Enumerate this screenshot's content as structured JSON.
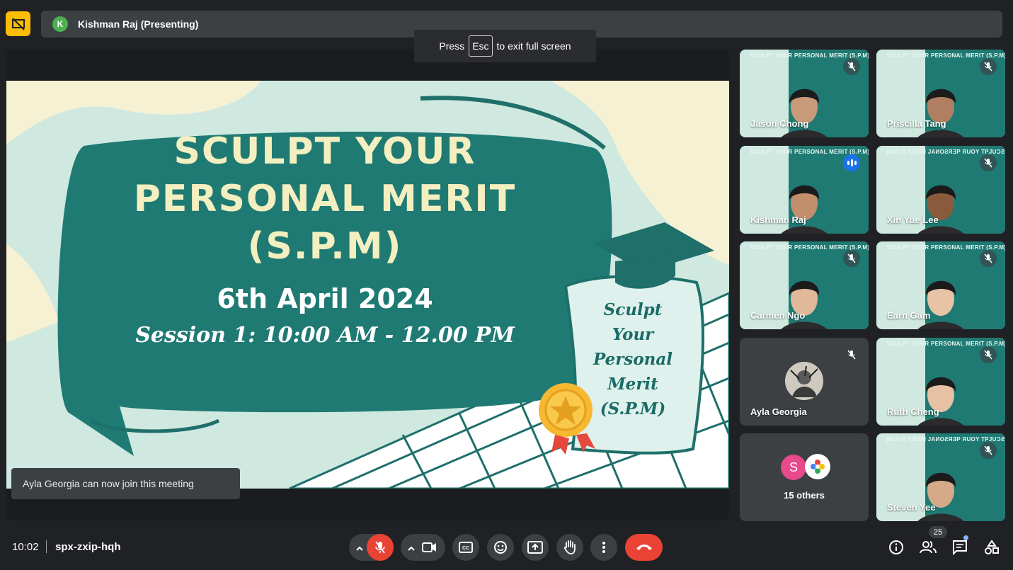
{
  "top_bar": {
    "presenter_initial": "K",
    "presenter_label": "Kishman Raj (Presenting)"
  },
  "fullscreen_hint": {
    "prefix": "Press",
    "key": "Esc",
    "suffix": "to exit full screen"
  },
  "slide": {
    "title_line1": "SCULPT YOUR",
    "title_line2": "PERSONAL MERIT",
    "title_line3": "(S.P.M)",
    "date": "6th April 2024",
    "session": "Session 1: 10:00 AM - 12.00 PM",
    "scroll_line1": "Sculpt",
    "scroll_line2": "Your",
    "scroll_line3": "Personal",
    "scroll_line4": "Merit",
    "scroll_line5": "(S.P.M)"
  },
  "toast": {
    "text": "Ayla Georgia can now join this meeting"
  },
  "participants": [
    {
      "name": "Jason Chong",
      "banner": "SCULPT YOUR PERSONAL MERIT (S.P.M)",
      "muted": true
    },
    {
      "name": "Priscilla Tang",
      "banner": "SCULPT YOUR PERSONAL MERIT (S.P.M)",
      "muted": true
    },
    {
      "name": "Kishman Raj",
      "banner": "SCULPT YOUR PERSONAL MERIT (S.P.M)",
      "muted": false,
      "speaking": true
    },
    {
      "name": "Xin Yue Lee",
      "banner": "(M.P.2) TIЯƎM JAИOƧЯƎP ЯUOY TPJUƆƧ",
      "muted": true
    },
    {
      "name": "Carmen Ngo",
      "banner": "SCULPT YOUR PERSONAL MERIT (S.P.M)",
      "muted": true
    },
    {
      "name": "Earn Gam",
      "banner": "SCULPT YOUR PERSONAL MERIT (S.P.M)",
      "muted": true
    },
    {
      "name": "Ayla Georgia",
      "banner": "",
      "muted": true
    },
    {
      "name": "Ruth Cheng",
      "banner": "SCULPT YOUR PERSONAL MERIT (S.P.M)",
      "muted": true
    },
    {
      "name": "Steven Yee",
      "banner": "(M.P.2) TIЯƎM JAИOƧЯƎP ЯUOY TPJUƆƧ",
      "muted": true
    }
  ],
  "others_tile": {
    "initial": "S",
    "label": "15 others"
  },
  "bottom_bar": {
    "time": "10:02",
    "meeting_code": "spx-zxip-hqh",
    "people_count": "25"
  },
  "colors": {
    "background": "#202124",
    "accent_yellow": "#fbbc04",
    "end_call_red": "#ea4335",
    "slide_teal": "#1f7a73"
  }
}
